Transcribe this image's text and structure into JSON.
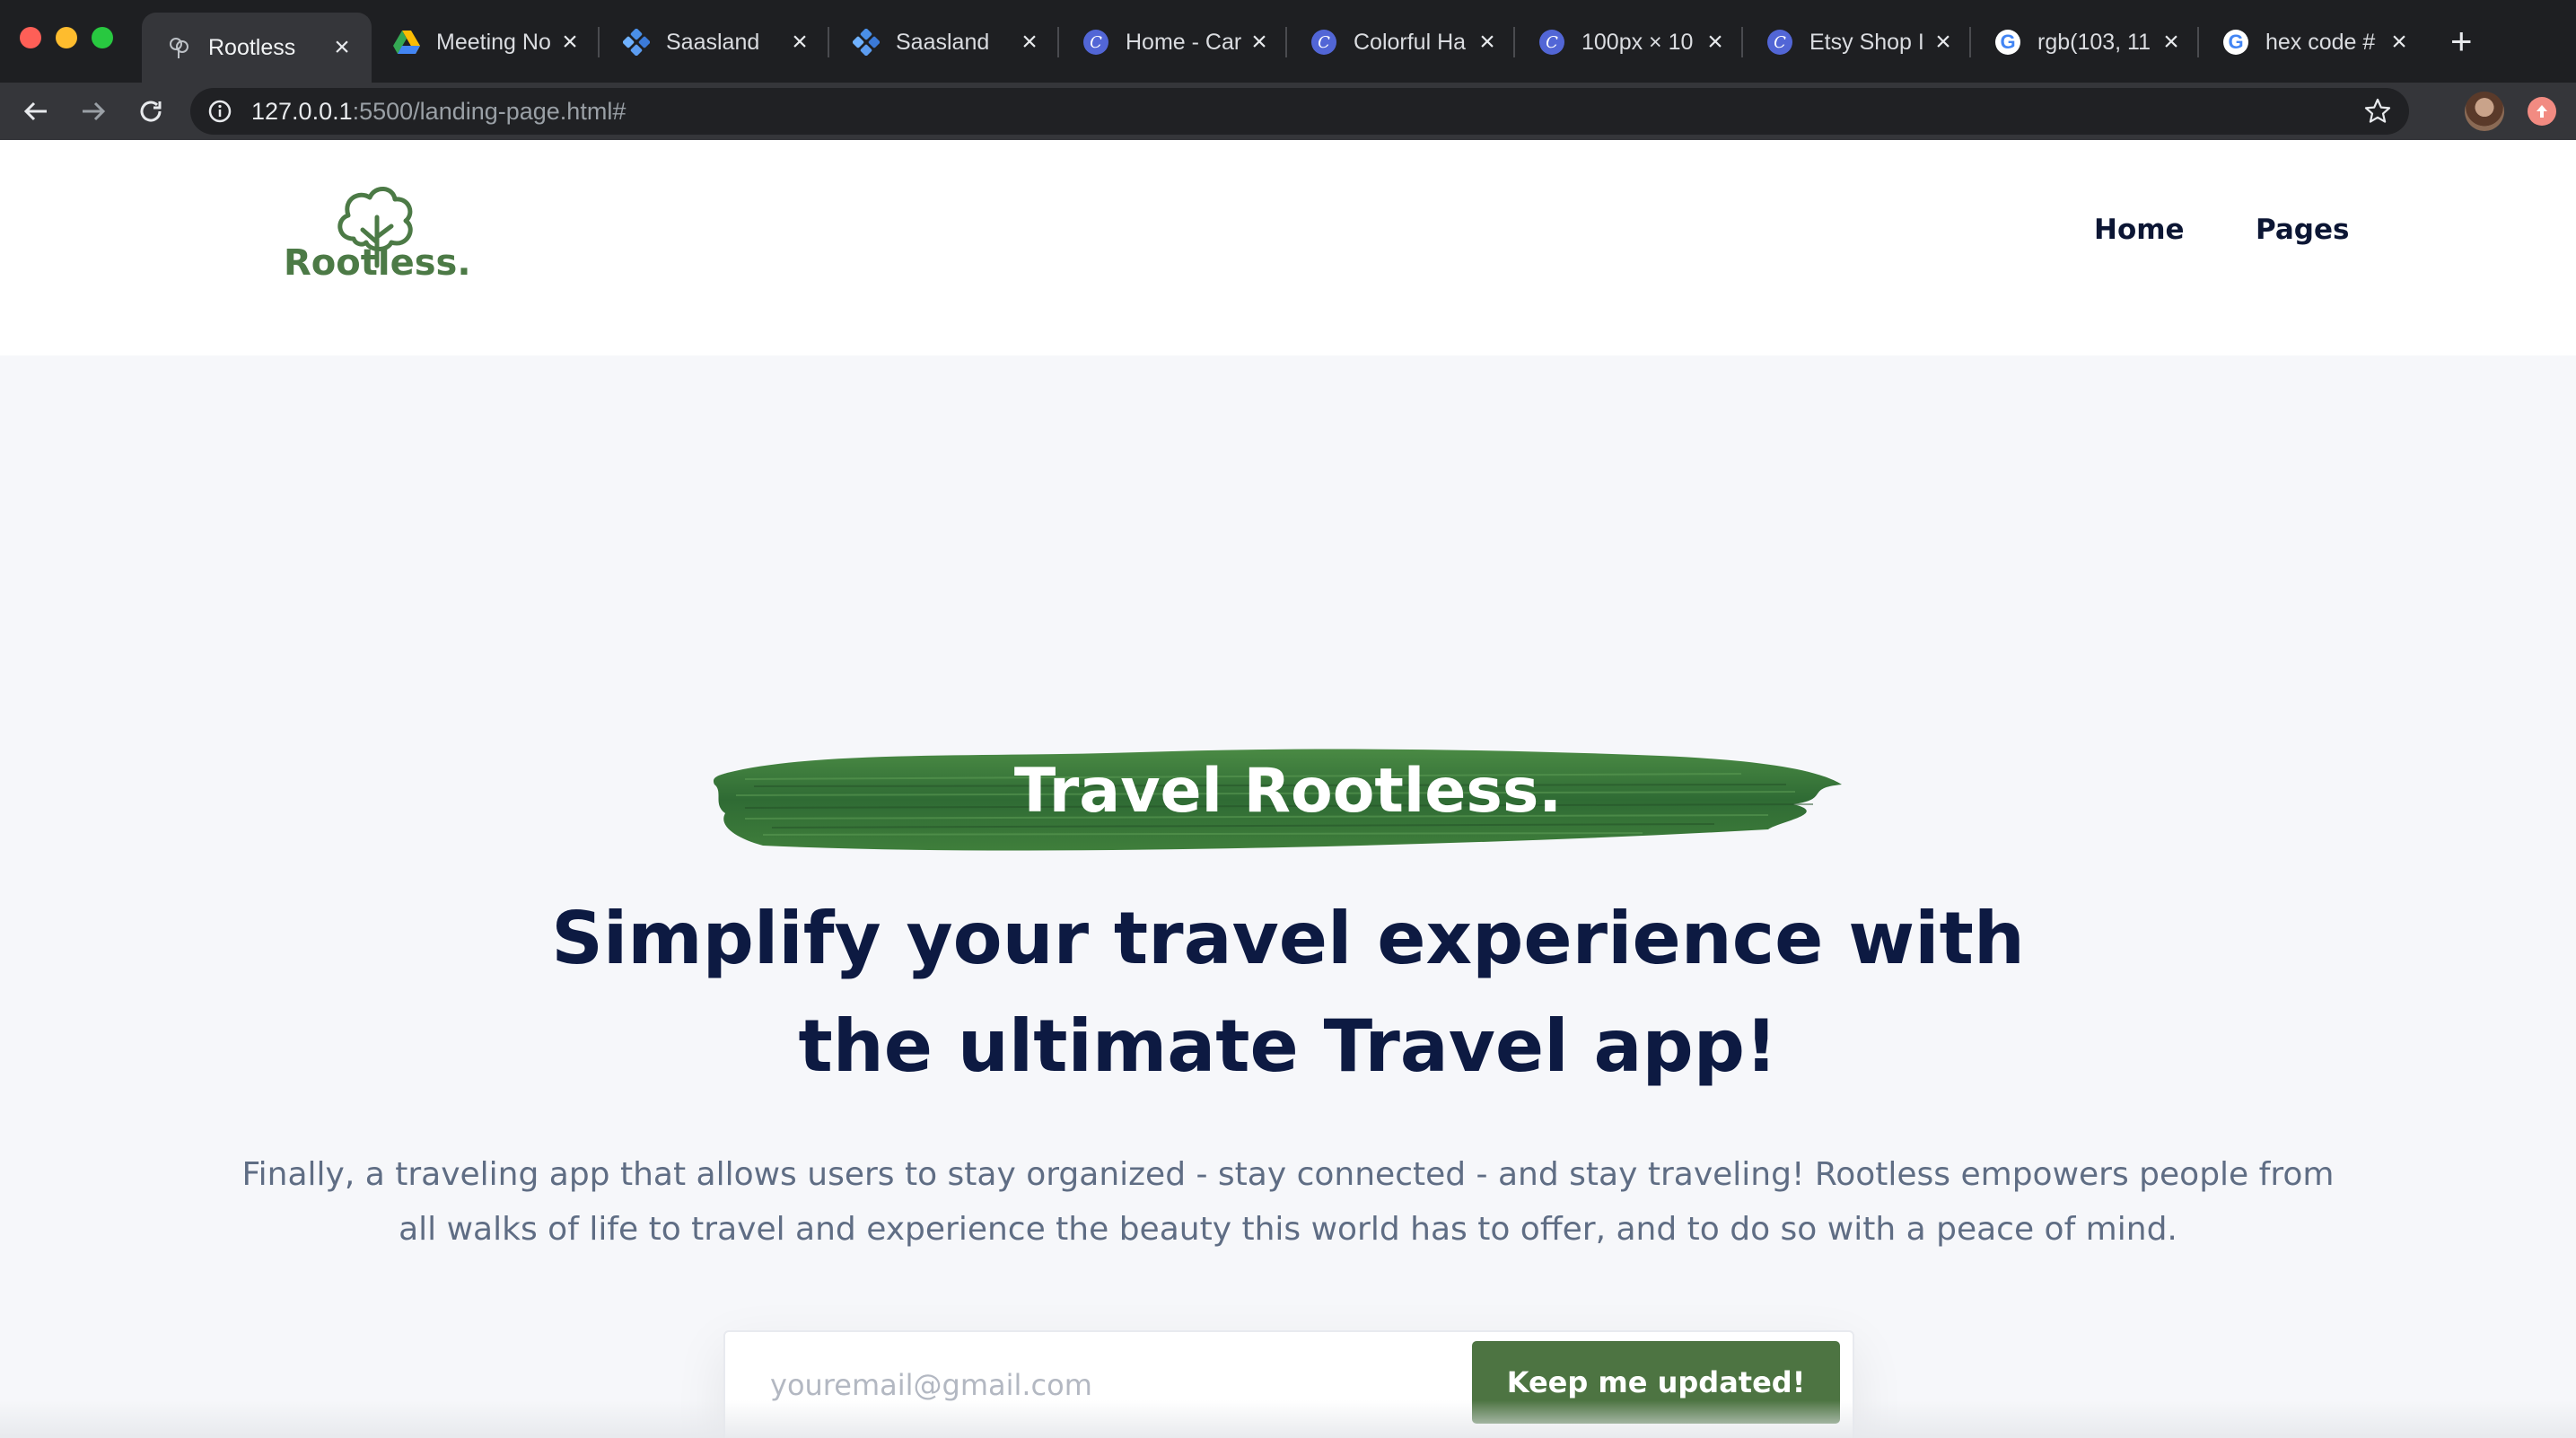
{
  "browser": {
    "tabs": [
      {
        "title": "Rootless",
        "favicon": "tree-icon",
        "active": true
      },
      {
        "title": "Meeting No",
        "favicon": "google-drive-icon"
      },
      {
        "title": "Saasland",
        "favicon": "saasland-icon"
      },
      {
        "title": "Saasland",
        "favicon": "saasland-icon"
      },
      {
        "title": "Home - Car",
        "favicon": "c-icon"
      },
      {
        "title": "Colorful Ha",
        "favicon": "c-icon"
      },
      {
        "title": "100px × 10",
        "favicon": "c-icon"
      },
      {
        "title": "Etsy Shop I",
        "favicon": "c-icon"
      },
      {
        "title": "rgb(103, 11",
        "favicon": "google-icon"
      },
      {
        "title": "hex code #",
        "favicon": "google-icon"
      }
    ],
    "url_host": "127.0.0.1",
    "url_rest": ":5500/landing-page.html#",
    "close_glyph": "×",
    "new_tab_glyph": "+"
  },
  "site": {
    "logo_text": "Rootless.",
    "nav": {
      "home": "Home",
      "pages": "Pages"
    },
    "hero": {
      "brush_title": "Travel Rootless.",
      "headline": {
        "p1": "Simplify your ",
        "b1": "travel experience",
        "p2": " with",
        "p3": "the ultimate ",
        "b2": "Travel",
        "p4": " app!"
      },
      "subtext": "Finally, a traveling app that allows users to stay organized - stay connected - and stay traveling! Rootless empowers people from all walks of life to travel and experience the beauty this world has to offer, and to do so with a peace of mind.",
      "email_placeholder": "youremail@gmail.com",
      "cta_label": "Keep me updated!"
    }
  },
  "colors": {
    "brand_green": "#4d7442",
    "headline_navy": "#0d1a42",
    "page_bg": "#f6f7fa"
  }
}
